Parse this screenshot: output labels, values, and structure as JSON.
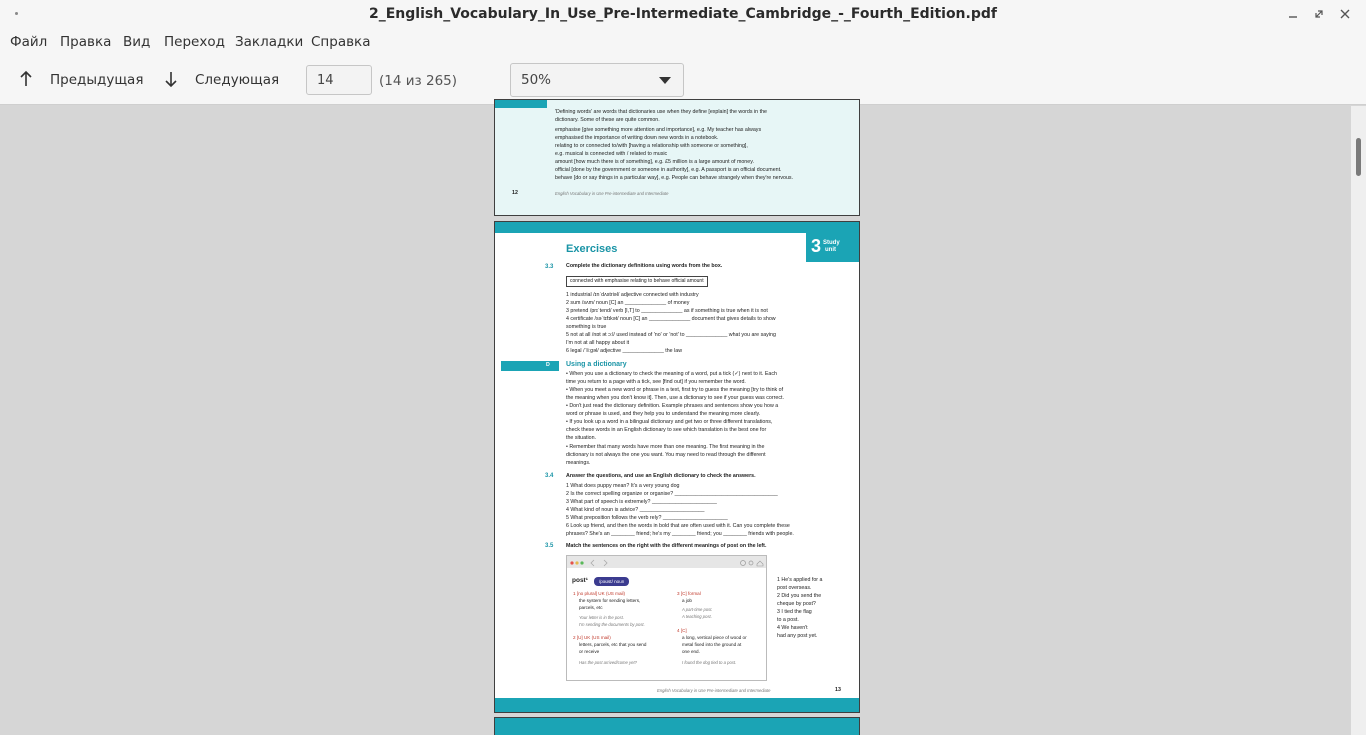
{
  "window": {
    "title": "2_English_Vocabulary_In_Use_Pre-Intermediate_Cambridge_-_Fourth_Edition.pdf"
  },
  "menu": [
    "Файл",
    "Правка",
    "Вид",
    "Переход",
    "Закладки",
    "Справка"
  ],
  "toolbar": {
    "prev_label": "Предыдущая",
    "next_label": "Следующая",
    "page_value": "14",
    "page_count": "(14 из 265)",
    "zoom_value": "50%"
  },
  "doc": {
    "top_page": {
      "lines": [
        "'Defining words' are words that dictionaries use when they define [explain] the words in the",
        "dictionary. Some of these are quite common.",
        "emphasise [give something more attention and importance], e.g. My teacher has always",
        "emphasised the importance of writing down new words in a notebook.",
        "relating to or connected to/with [having a relationship with someone or something],",
        "e.g. musical is connected with / related to music",
        "amount [how much there is of something], e.g. £5 million is a large amount of money.",
        "official [done by the government or someone in authority], e.g. A passport is an official document.",
        "behave [do or say things in a particular way], e.g. People can behave strangely when they're nervous."
      ],
      "page_number": "12",
      "footer": "English Vocabulary in Use Pre-intermediate and Intermediate"
    },
    "main_page": {
      "heading": "Exercises",
      "unit_number": "3",
      "unit_label_1": "Study",
      "unit_label_2": "unit",
      "ex33_num": "3.3",
      "ex33_title": "Complete the dictionary definitions using words from the box.",
      "word_box": "connected with     emphasise     relating to     behave     official     amount",
      "ex33_lines": [
        "1  industrial /ɪnˈdʌstriəl/ adjective  connected with  industry",
        "2  sum /sʌm/ noun [C] an ______________ of money",
        "3  pretend /prɪˈtend/ verb [I,T] to ______________ as if something is true when it is not",
        "4  certificate /səˈtɪfɪkət/ noun [C] an ______________ document that gives details to show",
        "    something is true",
        "5  not at all /nɒt ət ɔːl/ used instead of 'no' or 'not' to ______________ what you are saying",
        "    I'm not at all happy about it",
        "6  legal /ˈliːgəl/ adjective ______________ the law"
      ],
      "section_letter": "D",
      "section_title": "Using a dictionary",
      "section_lines": [
        "•  When you use a dictionary to check the meaning of a word, put a tick (✓) next to it. Each",
        "    time you return to a page with a tick, see [find out] if you remember the word.",
        "•  When you meet a new word or phrase in a text, first try to guess the meaning [try to think of",
        "    the meaning when you don't know it]. Then, use a dictionary to see if your guess was correct.",
        "•  Don't just read the dictionary definition. Example phrases and sentences show you how a",
        "    word or phrase is used, and they help you to understand the meaning more clearly.",
        "•  If you look up a word in a bilingual dictionary and get two or three different translations,",
        "    check these words in an English dictionary to see which translation is the best one for",
        "    the situation.",
        "•  Remember that many words have more than one meaning. The first meaning in the",
        "    dictionary is not always the one you want. You may need to read through the different",
        "    meanings."
      ],
      "ex34_num": "3.4",
      "ex34_title": "Answer the questions, and use an English dictionary to check the answers.",
      "ex34_lines": [
        "1  What does puppy mean?     It's a very young dog",
        "2  Is the correct spelling organize or organise?  ___________________________________",
        "3  What part of speech is extremely?  ______________________",
        "4  What kind of noun is advice?  ______________________",
        "5  What preposition follows the verb rely?  ______________________",
        "6  Look up friend, and then the words in bold that are often used with it. Can you complete these",
        "    phrases? She's an ________ friend; he's my ________ friend; you ________ friends with people."
      ],
      "ex35_num": "3.5",
      "ex35_title": "Match the sentences on the right with the different meanings of post on the left.",
      "dict_headword": "post¹",
      "dict_pron": "/pəʊst/ noun",
      "dict_left": [
        "1  [no plural] UK (US mail)",
        "the system for sending letters,",
        "parcels, etc",
        "Your letter is in the post.",
        "I'm sending the documents by post.",
        "2  [U] UK (US mail)",
        "letters, parcels, etc that you send",
        "or receive",
        "Has the post arrived/come yet?"
      ],
      "dict_right": [
        "3  [C] formal",
        "a job",
        "A part-time post.",
        "A teaching post.",
        "4  [C]",
        "a long, vertical piece of wood or",
        "metal fixed into the ground at",
        "one end.",
        "I found the dog tied to a post."
      ],
      "match_sentences": [
        "1  He's applied for a",
        "    post overseas.",
        "2  Did you send the",
        "    cheque by post?",
        "3  I tied the flag",
        "    to a post.",
        "4  We haven't",
        "    had any post yet."
      ],
      "footer": "English Vocabulary in Use Pre-intermediate and Intermediate",
      "page_number": "13"
    }
  }
}
